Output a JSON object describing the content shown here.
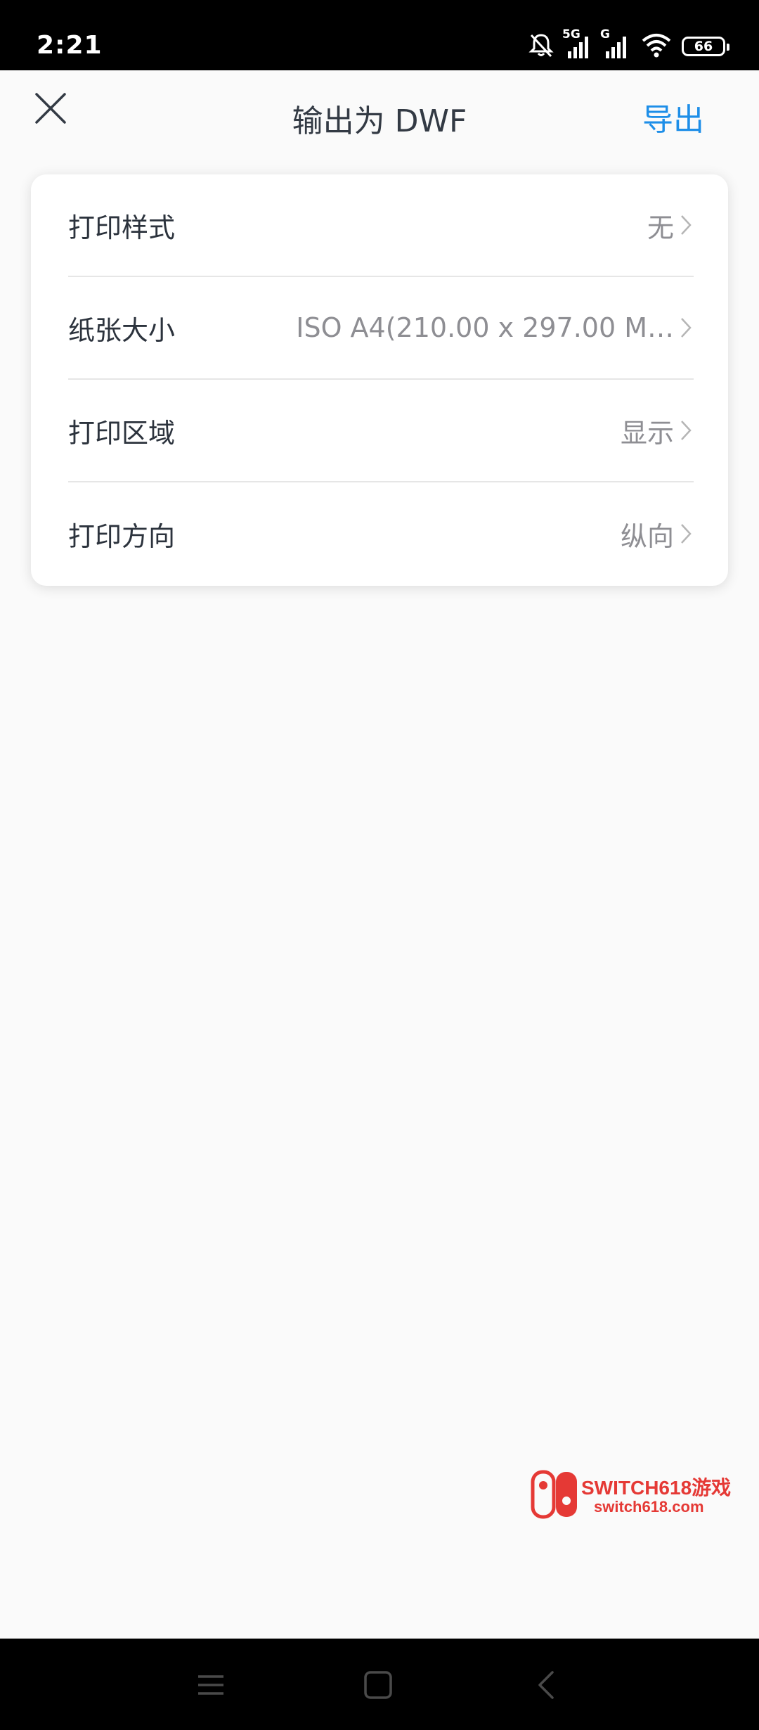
{
  "status_bar": {
    "time": "2:21",
    "signal1_label": "5G",
    "signal2_label": "G",
    "battery": "66",
    "icons": [
      "bell-muted-icon",
      "signal-icon",
      "signal-icon",
      "wifi-icon",
      "battery-icon"
    ]
  },
  "header": {
    "title": "输出为 DWF",
    "export_label": "导出",
    "close_icon": "close-icon"
  },
  "settings": [
    {
      "label": "打印样式",
      "value": "无"
    },
    {
      "label": "纸张大小",
      "value": "ISO A4(210.00 x 297.00 M…"
    },
    {
      "label": "打印区域",
      "value": "显示"
    },
    {
      "label": "打印方向",
      "value": "纵向"
    }
  ],
  "watermark": {
    "line1": "SWITCH618游戏",
    "line2": "switch618.com"
  },
  "nav_bar": {
    "icons": [
      "menu-icon",
      "home-square-icon",
      "back-icon"
    ]
  },
  "colors": {
    "accent": "#1d8ee8",
    "watermark": "#e53935",
    "background": "#fafafa"
  }
}
